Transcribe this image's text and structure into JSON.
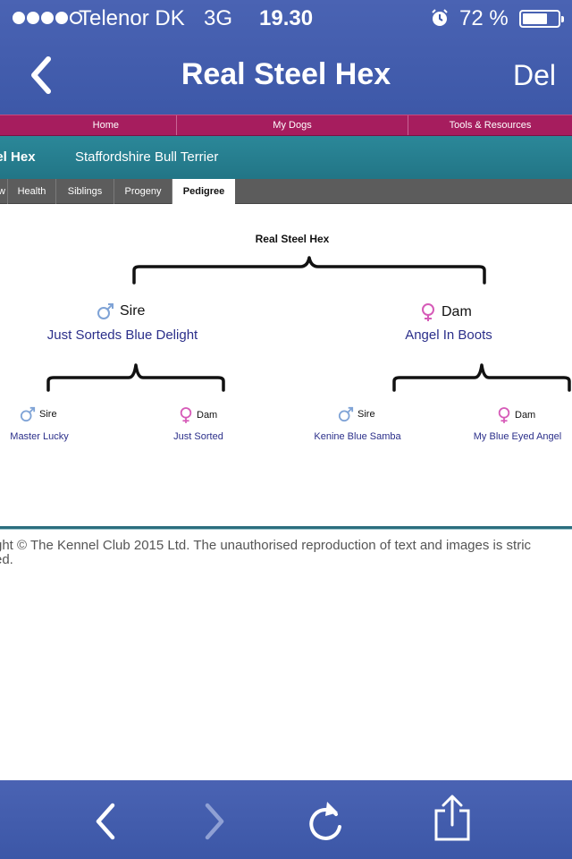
{
  "status_bar": {
    "carrier": "Telenor DK",
    "network": "3G",
    "time": "19.30",
    "battery": "72 %",
    "battery_level": 0.72
  },
  "navbar": {
    "title": "Real Steel Hex",
    "right_label": "Del"
  },
  "menu": {
    "items": [
      "Home",
      "My Dogs",
      "Tools & Resources"
    ]
  },
  "dog": {
    "name": "teel Hex",
    "breed": "Staffordshire Bull Terrier"
  },
  "tabs": [
    "w",
    "Health",
    "Siblings",
    "Progeny",
    "Pedigree"
  ],
  "active_tab": "Pedigree",
  "pedigree": {
    "root": "Real Steel Hex",
    "sire": {
      "role": "Sire",
      "name": "Just Sorteds Blue Delight",
      "sire": {
        "role": "Sire",
        "name": "Master Lucky"
      },
      "dam": {
        "role": "Dam",
        "name": "Just Sorted"
      }
    },
    "dam": {
      "role": "Dam",
      "name": "Angel In Boots",
      "sire": {
        "role": "Sire",
        "name": "Kenine Blue Samba"
      },
      "dam": {
        "role": "Dam",
        "name": "My Blue Eyed Angel"
      }
    }
  },
  "footer": {
    "line1": "ght © The Kennel Club 2015 Ltd. The unauthorised reproduction of text and images is stric",
    "line2": "ed."
  },
  "colors": {
    "ios_blue": "#4a63b3",
    "menu_magenta": "#a61d5e",
    "header_teal": "#227586",
    "link_navy": "#2b2f8a",
    "male_icon": "#7fa3d6",
    "female_icon": "#d65bb8"
  },
  "icons": {
    "male": "male-symbol-icon",
    "female": "female-symbol-icon"
  }
}
